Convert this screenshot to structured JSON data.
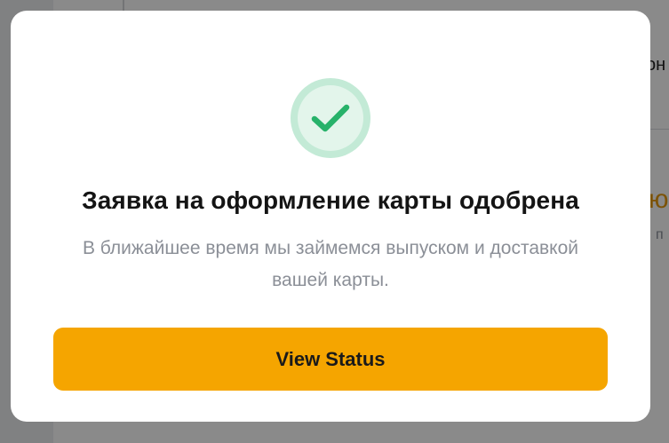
{
  "background": {
    "text_1": "он",
    "text_2": "ю",
    "text_3": "п"
  },
  "dialog": {
    "icon": "check-icon",
    "title": "Заявка на оформление карты одобрена",
    "message": "В ближайшее время мы займемся выпуском и доставкой вашей карты.",
    "button_label": "View Status",
    "colors": {
      "accent": "#f5a500",
      "success": "#27b26a",
      "success_ring": "#c3ead6"
    }
  }
}
